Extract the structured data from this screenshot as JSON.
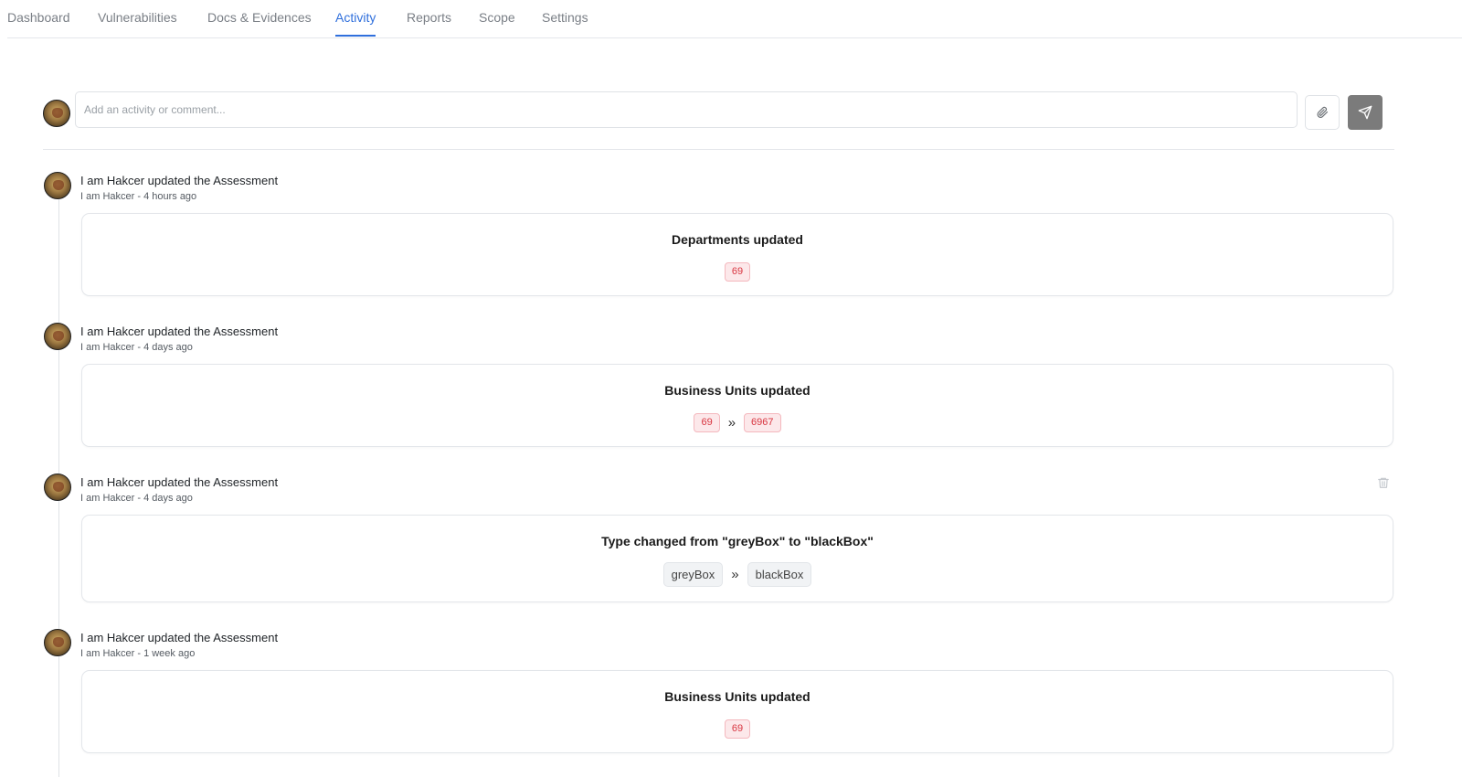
{
  "tabs": [
    {
      "label": "Dashboard"
    },
    {
      "label": "Vulnerabilities"
    },
    {
      "label": "Docs & Evidences"
    },
    {
      "label": "Activity",
      "active": true
    },
    {
      "label": "Reports"
    },
    {
      "label": "Scope"
    },
    {
      "label": "Settings"
    }
  ],
  "composer": {
    "placeholder": "Add an activity or comment...",
    "attach_icon": "paperclip-icon",
    "send_icon": "send-icon"
  },
  "activities": [
    {
      "title": "I am Hakcer updated the Assessment",
      "meta": "I am Hakcer - 4 hours ago",
      "card_title": "Departments updated",
      "from": "69"
    },
    {
      "title": "I am Hakcer updated the Assessment",
      "meta": "I am Hakcer - 4 days ago",
      "card_title": "Business Units updated",
      "from": "69",
      "arrow": "»",
      "to": "6967"
    },
    {
      "title": "I am Hakcer updated the Assessment",
      "meta": "I am Hakcer - 4 days ago",
      "card_title": "Type changed from \"greyBox\" to \"blackBox\"",
      "from": "greyBox",
      "arrow": "»",
      "to": "blackBox",
      "delete_icon": "trash-icon"
    },
    {
      "title": "I am Hakcer updated the Assessment",
      "meta": "I am Hakcer - 1 week ago",
      "card_title": "Business Units updated",
      "from": "69"
    }
  ],
  "colors": {
    "accent": "#2f6fdc",
    "chip_red_text": "#d8343f",
    "chip_red_bg": "#fce8ea",
    "send_button": "#7b7b7b"
  }
}
